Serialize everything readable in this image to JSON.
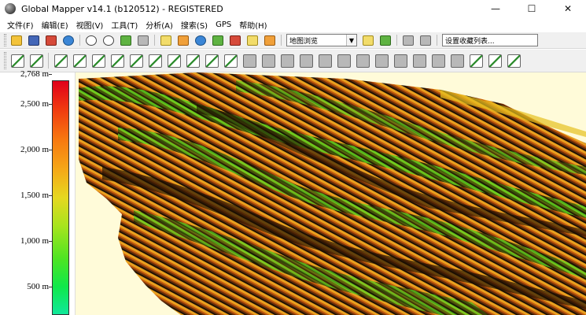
{
  "window": {
    "title": "Global Mapper v14.1 (b120512) - REGISTERED",
    "minimize_glyph": "—",
    "maximize_glyph": "☐",
    "close_glyph": "✕"
  },
  "menu": [
    "文件(F)",
    "编辑(E)",
    "视图(V)",
    "工具(T)",
    "分析(A)",
    "搜索(S)",
    "GPS",
    "帮助(H)"
  ],
  "toolbar1": {
    "icons_left": [
      "folder-open-icon",
      "save-icon",
      "layer-control-icon",
      "globe-icon",
      "zoom-in-icon",
      "zoom-out-icon",
      "zoom-full-icon",
      "zoom-box-icon",
      "pan-icon",
      "measure-icon",
      "feature-info-icon",
      "path-profile-icon",
      "digitizer-icon",
      "draw-icon",
      "filter-icon"
    ],
    "mode_select_value": "地图浏览",
    "icons_right": [
      "shader-icon",
      "3d-view-icon",
      "raster-options-icon",
      "vector-options-icon"
    ],
    "settings_select_value": "设置收藏列表..."
  },
  "toolbar2": {
    "icons": [
      "create-point-icon",
      "create-line-icon",
      "create-area-icon",
      "create-text-icon",
      "edit-vertex-icon",
      "move-feature-icon",
      "rotate-feature-icon",
      "scale-feature-icon",
      "split-feature-icon",
      "join-feature-icon",
      "delete-feature-icon",
      "copy-feature-icon",
      "paste-feature-icon",
      "buffer-icon",
      "intersect-icon",
      "union-icon",
      "difference-icon",
      "crop-icon",
      "simplify-icon",
      "smooth-icon",
      "extract-icon",
      "fill-icon",
      "measure-area-icon",
      "snap-icon",
      "grid-icon",
      "undo-icon",
      "redo-icon"
    ]
  },
  "legend": {
    "ticks": [
      "2,768 m",
      "2,500 m",
      "2,000 m",
      "1,500 m",
      "1,000 m",
      "500 m"
    ],
    "values": [
      2768,
      2500,
      2000,
      1500,
      1000,
      500
    ],
    "range": [
      0,
      2768
    ],
    "colors": [
      "#e0001a",
      "#f77810",
      "#e6d820",
      "#4fe422",
      "#10e89a"
    ]
  },
  "map": {
    "background_color": "#fffbd9"
  }
}
